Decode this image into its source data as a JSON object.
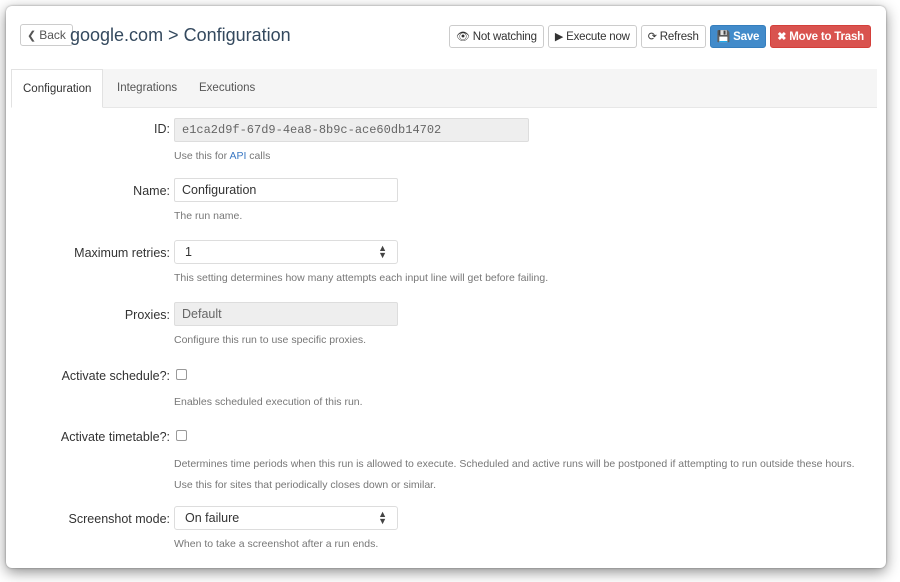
{
  "header": {
    "back_label": "Back",
    "breadcrumb": "google.com > Configuration",
    "actions": {
      "watch": "Not watching",
      "execute": "Execute now",
      "refresh": "Refresh",
      "save": "Save",
      "trash": "Move to Trash"
    }
  },
  "tabs": [
    {
      "label": "Configuration",
      "active": true
    },
    {
      "label": "Integrations",
      "active": false
    },
    {
      "label": "Executions",
      "active": false
    }
  ],
  "form": {
    "id": {
      "label": "ID:",
      "value": "e1ca2d9f-67d9-4ea8-8b9c-ace60db14702",
      "help_prefix": "Use this for ",
      "help_link": "API",
      "help_suffix": " calls"
    },
    "name": {
      "label": "Name:",
      "value": "Configuration",
      "help": "The run name."
    },
    "retries": {
      "label": "Maximum retries:",
      "value": "1",
      "help": "This setting determines how many attempts each input line will get before failing."
    },
    "proxies": {
      "label": "Proxies:",
      "value": "Default",
      "help": "Configure this run to use specific proxies."
    },
    "schedule": {
      "label": "Activate schedule?:",
      "checked": false,
      "help": "Enables scheduled execution of this run."
    },
    "timetable": {
      "label": "Activate timetable?:",
      "checked": false,
      "help": "Determines time periods when this run is allowed to execute. Scheduled and active runs will be postponed if attempting to run outside these hours. Use this for sites that periodically closes down or similar."
    },
    "screenshot": {
      "label": "Screenshot mode:",
      "value": "On failure",
      "help": "When to take a screenshot after a run ends."
    }
  },
  "colors": {
    "primary": "#428bca",
    "danger": "#d9534f",
    "link": "#3a78c3"
  }
}
